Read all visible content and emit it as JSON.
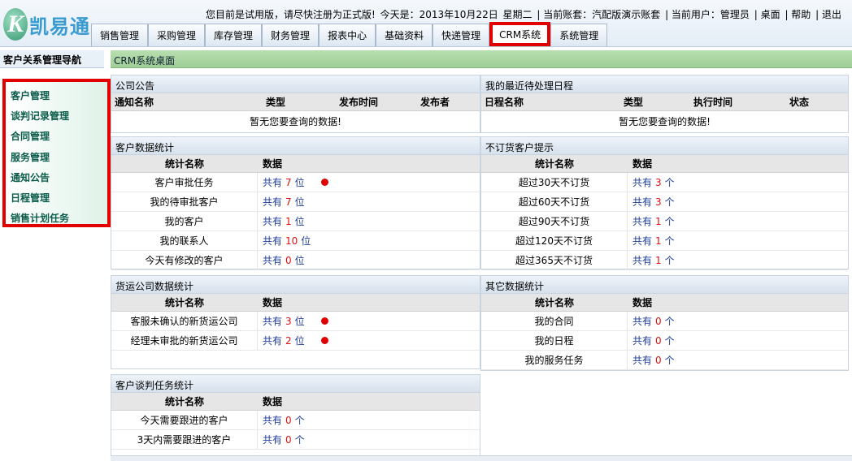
{
  "app": {
    "logo_letter": "K",
    "logo_text": "凯易通"
  },
  "infobar": {
    "trial_notice": "您目前是试用版，请尽快注册为正式版!",
    "today": "今天是：2013年10月22日",
    "weekday": "星期二",
    "account": "| 当前账套：汽配版演示账套",
    "user": "| 当前用户：管理员",
    "desktop": "| 桌面",
    "help": "| 帮助",
    "exit": "| 退出"
  },
  "tabs": [
    {
      "label": "销售管理"
    },
    {
      "label": "采购管理"
    },
    {
      "label": "库存管理"
    },
    {
      "label": "财务管理"
    },
    {
      "label": "报表中心"
    },
    {
      "label": "基础资料"
    },
    {
      "label": "快递管理"
    },
    {
      "label": "CRM系统",
      "active": true
    },
    {
      "label": "系统管理"
    }
  ],
  "sidebar": {
    "header": "客户关系管理导航",
    "items": [
      {
        "label": "客户管理"
      },
      {
        "label": "谈判记录管理"
      },
      {
        "label": "合同管理"
      },
      {
        "label": "服务管理"
      },
      {
        "label": "通知公告"
      },
      {
        "label": "日程管理"
      },
      {
        "label": "销售计划任务"
      }
    ]
  },
  "main": {
    "title": "CRM系统桌面",
    "announcements": {
      "title": "公司公告",
      "columns": [
        "通知名称",
        "类型",
        "发布时间",
        "发布者"
      ],
      "empty": "暂无您要查询的数据!"
    },
    "schedule": {
      "title": "我的最近待处理日程",
      "columns": [
        "日程名称",
        "类型",
        "执行时间",
        "状态"
      ],
      "empty": "暂无您要查询的数据!"
    },
    "customer_stats": {
      "title": "客户数据统计",
      "col_name": "统计名称",
      "col_data": "数据",
      "prefix": "共有",
      "rows": [
        {
          "name": "客户审批任务",
          "count": "7",
          "unit": "位",
          "alert": true
        },
        {
          "name": "我的待审批客户",
          "count": "7",
          "unit": "位"
        },
        {
          "name": "我的客户",
          "count": "1",
          "unit": "位"
        },
        {
          "name": "我的联系人",
          "count": "10",
          "unit": "位"
        },
        {
          "name": "今天有修改的客户",
          "count": "0",
          "unit": "位"
        }
      ]
    },
    "no_order": {
      "title": "不订货客户提示",
      "col_name": "统计名称",
      "col_data": "数据",
      "prefix": "共有",
      "rows": [
        {
          "name": "超过30天不订货",
          "count": "3",
          "unit": "个"
        },
        {
          "name": "超过60天不订货",
          "count": "3",
          "unit": "个"
        },
        {
          "name": "超过90天不订货",
          "count": "1",
          "unit": "个"
        },
        {
          "name": "超过120天不订货",
          "count": "1",
          "unit": "个"
        },
        {
          "name": "超过365天不订货",
          "count": "1",
          "unit": "个"
        }
      ]
    },
    "freight_stats": {
      "title": "货运公司数据统计",
      "col_name": "统计名称",
      "col_data": "数据",
      "prefix": "共有",
      "rows": [
        {
          "name": "客服未确认的新货运公司",
          "count": "3",
          "unit": "位",
          "alert": true
        },
        {
          "name": "经理未审批的新货运公司",
          "count": "2",
          "unit": "位",
          "alert": true
        }
      ]
    },
    "other_stats": {
      "title": "其它数据统计",
      "col_name": "统计名称",
      "col_data": "数据",
      "prefix": "共有",
      "rows": [
        {
          "name": "我的合同",
          "count": "0",
          "unit": "个"
        },
        {
          "name": "我的日程",
          "count": "0",
          "unit": "个"
        },
        {
          "name": "我的服务任务",
          "count": "0",
          "unit": "个"
        }
      ]
    },
    "negotiation_stats": {
      "title": "客户谈判任务统计",
      "col_name": "统计名称",
      "col_data": "数据",
      "prefix": "共有",
      "rows": [
        {
          "name": "今天需要跟进的客户",
          "count": "0",
          "unit": "个"
        },
        {
          "name": "3天内需要跟进的客户",
          "count": "0",
          "unit": "个"
        }
      ]
    }
  },
  "colors": {
    "highlight": "#e00000",
    "accent_green": "#9fce96",
    "link_blue": "#1f3d99",
    "count_red": "#d11"
  }
}
